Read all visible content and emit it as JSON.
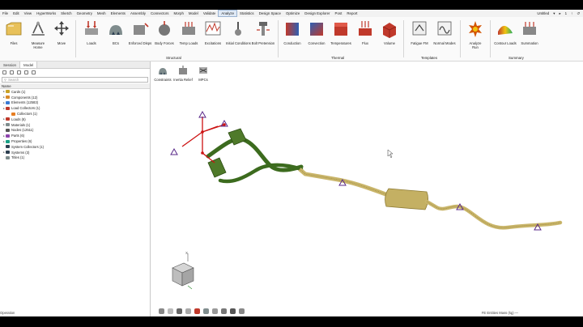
{
  "menu": [
    "File",
    "Edit",
    "View",
    "HyperWorks",
    "Sketch",
    "Geometry",
    "Mesh",
    "Elements",
    "Assembly",
    "Connectors",
    "Morph",
    "Model",
    "Validate",
    "Analyze",
    "Statistics",
    "Design Space",
    "Optimize",
    "Design Explorer",
    "Post",
    "Report"
  ],
  "menu_active_index": 13,
  "menubar_right": {
    "model_name": "Untitled",
    "items": [
      "▾",
      "▸",
      "1",
      "↑",
      "↺"
    ]
  },
  "ribbon": {
    "files": {
      "label": "Files"
    },
    "measure": {
      "label": "Measure",
      "sub": "Home"
    },
    "move": {
      "label": "Move"
    },
    "loads": {
      "label": "Loads"
    },
    "bcs": {
      "label": "BCs"
    },
    "enforced_disps": {
      "label": "Enforced Disps"
    },
    "body_forces": {
      "label": "Body Forces"
    },
    "temp_loads": {
      "label": "Temp Loads"
    },
    "excitations": {
      "label": "Excitations"
    },
    "initial_conditions": {
      "label": "Initial Conditions"
    },
    "bolt_pretension": {
      "label": "Bolt Pretension"
    },
    "structural_group": "Structural",
    "conduction": {
      "label": "Conduction"
    },
    "convection": {
      "label": "Convection"
    },
    "temperatures": {
      "label": "Temperatures"
    },
    "flux": {
      "label": "Flux"
    },
    "volume": {
      "label": "Volume"
    },
    "thermal_group": "Thermal",
    "fatigue_fm": {
      "label": "Fatigue FM"
    },
    "normal_modes": {
      "label": "Normal Modes"
    },
    "templates_group": "Templates",
    "analyze": {
      "label": "Analyze",
      "sub": "Run"
    },
    "contour_loads": {
      "label": "Contour Loads"
    },
    "summation": {
      "label": "Summation"
    },
    "summary_group": "Summary"
  },
  "panel": {
    "tabs": [
      "Session",
      "Model"
    ],
    "active_tab": 1,
    "search_placeholder": "Search",
    "column_header": "Name",
    "tree": [
      {
        "label": "Cards  (1)",
        "color": "#c9a227",
        "expandable": true
      },
      {
        "label": "Components  (12)",
        "color": "#d88a2a",
        "expandable": true
      },
      {
        "label": "Elements  (12583)",
        "color": "#3a7bd5",
        "expandable": true
      },
      {
        "label": "Load Collectors  (1)",
        "color": "#c0392b",
        "expandable": true
      },
      {
        "label": "Collectors  (1)",
        "color": "#e67e22",
        "expandable": false,
        "indent": true
      },
      {
        "label": "Loads  (6)",
        "color": "#c0392b",
        "expandable": true
      },
      {
        "label": "Materials  (1)",
        "color": "#7f8c8d",
        "expandable": true
      },
      {
        "label": "Nodes  (12511)",
        "color": "#555555",
        "expandable": false
      },
      {
        "label": "Parts  (6)",
        "color": "#8e44ad",
        "expandable": true
      },
      {
        "label": "Properties  (6)",
        "color": "#16a085",
        "expandable": true
      },
      {
        "label": "System Collectors  (1)",
        "color": "#2c3e50",
        "expandable": false
      },
      {
        "label": "Systems  (3)",
        "color": "#2c3e50",
        "expandable": true
      },
      {
        "label": "Titles  (1)",
        "color": "#7f8c8d",
        "expandable": false
      }
    ]
  },
  "subribbon": {
    "items": [
      "Constraints",
      "Inertia Relief",
      "MPCs"
    ]
  },
  "viewcube": {
    "axis_label": "X"
  },
  "status": {
    "left": "Operation",
    "right": "FE Entities  Mass (kg)  —"
  },
  "colors": {
    "part_green": "#3c6b1e",
    "part_tan": "#c9b56a",
    "constraint": "#5a2a8a",
    "node_red": "#cc1111"
  }
}
